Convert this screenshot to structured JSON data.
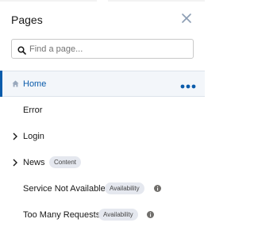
{
  "panel": {
    "title": "Pages",
    "search_placeholder": "Find a page..."
  },
  "pages": [
    {
      "label": "Home",
      "selected": true,
      "icon": "home-icon",
      "has_menu": true
    },
    {
      "label": "Error"
    },
    {
      "label": "Login",
      "expandable": true
    },
    {
      "label": "News",
      "expandable": true,
      "badge": "Content"
    },
    {
      "label": "Service Not Available",
      "badge": "Availability",
      "info": true
    },
    {
      "label": "Too Many Requests",
      "badge": "Availability",
      "info": true
    }
  ],
  "colors": {
    "accent": "#0b5cab",
    "selected_bg": "#f3f6fa",
    "badge_bg": "#e5e8ef"
  }
}
